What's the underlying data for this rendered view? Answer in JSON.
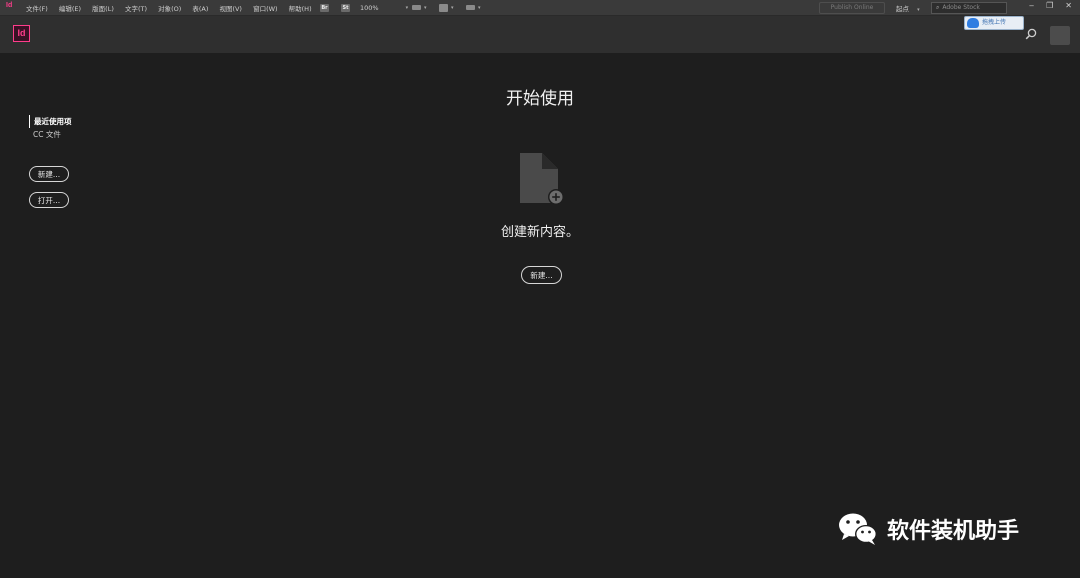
{
  "menubar": {
    "app_glyph": "Id",
    "menus": [
      "文件(F)",
      "编辑(E)",
      "版面(L)",
      "文字(T)",
      "对象(O)",
      "表(A)",
      "视图(V)",
      "窗口(W)",
      "帮助(H)"
    ],
    "br_label": "Br",
    "st_label": "St",
    "zoom": "100%",
    "publish_online": "Publish Online",
    "workspace": "起点",
    "stock_placeholder": "Adobe Stock"
  },
  "header": {
    "logo": "Id",
    "upload_button": "拖拽上传"
  },
  "sidebar": {
    "items": [
      {
        "label": "最近使用项",
        "active": true
      },
      {
        "label": "CC 文件",
        "active": false
      }
    ],
    "new_button": "新建...",
    "open_button": "打开..."
  },
  "main": {
    "title": "开始使用",
    "subtitle": "创建新内容。",
    "new_button": "新建..."
  },
  "watermark": {
    "text": "软件装机助手"
  },
  "colors": {
    "indesign_pink": "#ff3d8b",
    "background": "#1e1e1e",
    "header_bg": "#2f2f2f",
    "menubar_bg": "#3a3a3a"
  }
}
